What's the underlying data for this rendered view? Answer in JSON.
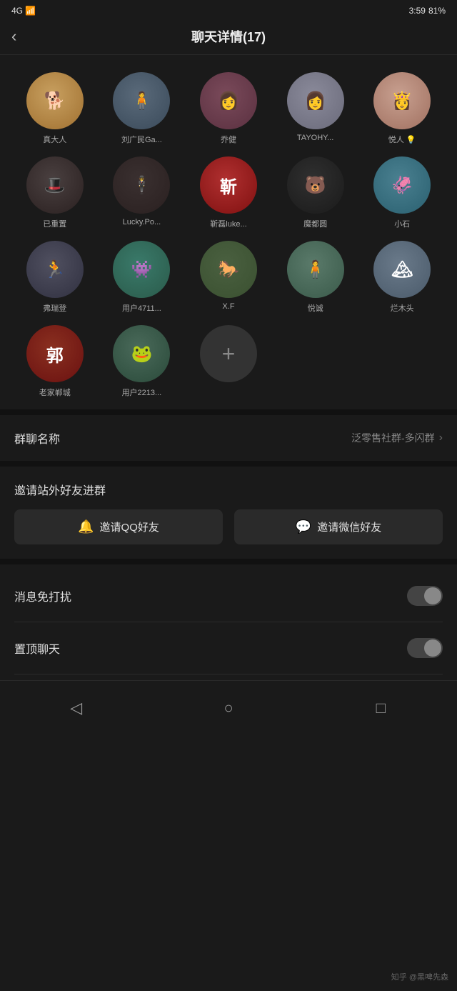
{
  "statusBar": {
    "left": "4G",
    "signal": "▲",
    "time": "3:59",
    "battery": "81%"
  },
  "header": {
    "backLabel": "‹",
    "title": "聊天详情(17)"
  },
  "members": [
    {
      "id": 1,
      "name": "真大人",
      "avatarClass": "av-shiba",
      "avatarEmoji": "🐕"
    },
    {
      "id": 2,
      "name": "刘广民Ga...",
      "avatarClass": "av-person1",
      "avatarEmoji": "🧍"
    },
    {
      "id": 3,
      "name": "乔健",
      "avatarClass": "av-person2",
      "avatarEmoji": "👩"
    },
    {
      "id": 4,
      "name": "TAYOHY...",
      "avatarClass": "av-person3",
      "avatarEmoji": "👩"
    },
    {
      "id": 5,
      "name": "悦人 💡",
      "avatarClass": "av-person4",
      "avatarEmoji": "👸"
    },
    {
      "id": 6,
      "name": "已重置",
      "avatarClass": "av-hat",
      "avatarEmoji": "🎩"
    },
    {
      "id": 7,
      "name": "Lucky.Po...",
      "avatarClass": "av-black",
      "avatarEmoji": "👤"
    },
    {
      "id": 8,
      "name": "靳磊luke...",
      "avatarClass": "av-red-text",
      "avatarEmoji": "靳"
    },
    {
      "id": 9,
      "name": "魔都圆",
      "avatarClass": "av-bear",
      "avatarEmoji": "🐻"
    },
    {
      "id": 10,
      "name": "小石",
      "avatarClass": "av-blue-monster",
      "avatarEmoji": "🦑"
    },
    {
      "id": 11,
      "name": "弗瑞登",
      "avatarClass": "av-runner",
      "avatarEmoji": "🏃"
    },
    {
      "id": 12,
      "name": "用户4711...",
      "avatarClass": "av-teal-monster",
      "avatarEmoji": "👾"
    },
    {
      "id": 13,
      "name": "X.F",
      "avatarClass": "av-horse",
      "avatarEmoji": "🐎"
    },
    {
      "id": 14,
      "name": "悦诚",
      "avatarClass": "av-field",
      "avatarEmoji": "🧍"
    },
    {
      "id": 15,
      "name": "烂木头",
      "avatarClass": "av-outdoor",
      "avatarEmoji": "🏔"
    },
    {
      "id": 16,
      "name": "老家郸城",
      "avatarClass": "av-郭",
      "avatarEmoji": "郭"
    },
    {
      "id": 17,
      "name": "用户2213...",
      "avatarClass": "av-frog",
      "avatarEmoji": "🐸"
    }
  ],
  "addButton": {
    "label": "+"
  },
  "groupName": {
    "label": "群聊名称",
    "value": "泛零售社群-多闪群"
  },
  "invite": {
    "title": "邀请站外好友进群",
    "qqButton": "邀请QQ好友",
    "wechatButton": "邀请微信好友",
    "qqIcon": "🔔",
    "wechatIcon": "💬"
  },
  "toggles": [
    {
      "label": "消息免打扰",
      "enabled": false
    },
    {
      "label": "置顶聊天",
      "enabled": false
    }
  ],
  "bottomNav": {
    "back": "◁",
    "home": "○",
    "recent": "□"
  },
  "watermark": "知乎 @黑啤先森"
}
